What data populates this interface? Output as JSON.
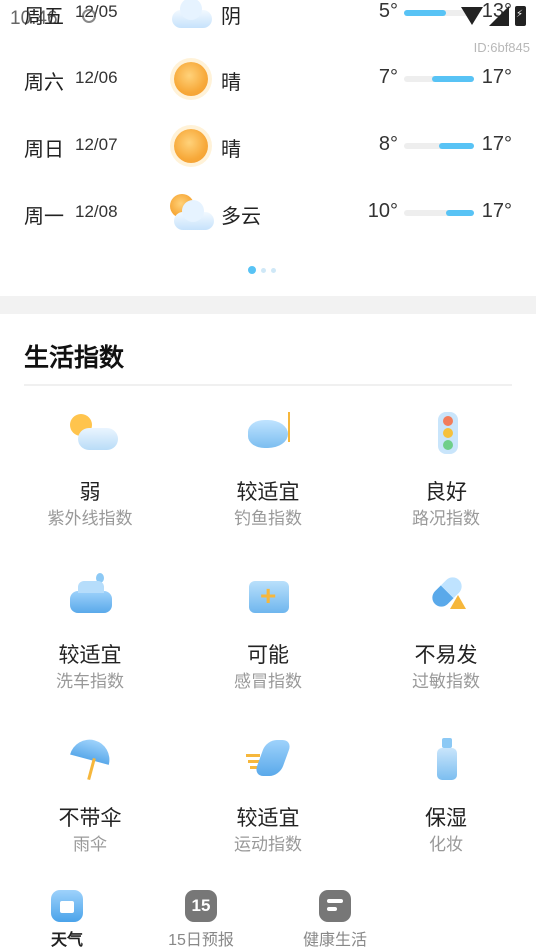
{
  "status_bar": {
    "time": "10:46",
    "icons": [
      "gear-icon",
      "wifi-icon",
      "cell-signal-icon",
      "battery-charging-icon"
    ],
    "device_id": "ID:6bf845"
  },
  "forecast": [
    {
      "day": "周五",
      "date": "12/05",
      "icon": "cloudy-icon",
      "cond": "阴",
      "low": "5°",
      "high": "13°",
      "range_fraction": [
        0.0,
        0.6
      ]
    },
    {
      "day": "周六",
      "date": "12/06",
      "icon": "sunny-icon",
      "cond": "晴",
      "low": "7°",
      "high": "17°",
      "range_fraction": [
        0.4,
        1.0
      ]
    },
    {
      "day": "周日",
      "date": "12/07",
      "icon": "sunny-icon",
      "cond": "晴",
      "low": "8°",
      "high": "17°",
      "range_fraction": [
        0.5,
        1.0
      ]
    },
    {
      "day": "周一",
      "date": "12/08",
      "icon": "partly-cloudy-icon",
      "cond": "多云",
      "low": "10°",
      "high": "17°",
      "range_fraction": [
        0.6,
        1.0
      ]
    }
  ],
  "pager": {
    "count": 3,
    "active": 0
  },
  "life": {
    "title": "生活指数",
    "items": [
      {
        "value": "弱",
        "name": "紫外线指数",
        "icon": "uv-sun-cloud-icon"
      },
      {
        "value": "较适宜",
        "name": "钓鱼指数",
        "icon": "fish-icon"
      },
      {
        "value": "良好",
        "name": "路况指数",
        "icon": "traffic-light-icon"
      },
      {
        "value": "较适宜",
        "name": "洗车指数",
        "icon": "car-wash-icon"
      },
      {
        "value": "可能",
        "name": "感冒指数",
        "icon": "medical-kit-icon"
      },
      {
        "value": "不易发",
        "name": "过敏指数",
        "icon": "pill-warning-icon"
      },
      {
        "value": "不带伞",
        "name": "雨伞",
        "icon": "umbrella-icon"
      },
      {
        "value": "较适宜",
        "name": "运动指数",
        "icon": "runner-icon"
      },
      {
        "value": "保湿",
        "name": "化妆",
        "icon": "cosmetic-bottle-icon"
      }
    ]
  },
  "tabs": [
    {
      "label": "天气",
      "icon": "home-icon",
      "active": true
    },
    {
      "label": "15日预报",
      "icon": "calendar-15-icon",
      "badge": "15",
      "active": false
    },
    {
      "label": "健康生活",
      "icon": "health-life-icon",
      "active": false
    }
  ],
  "colors": {
    "accent": "#58c3f5",
    "muted_text": "#999999",
    "band": "#f2f2f2"
  }
}
